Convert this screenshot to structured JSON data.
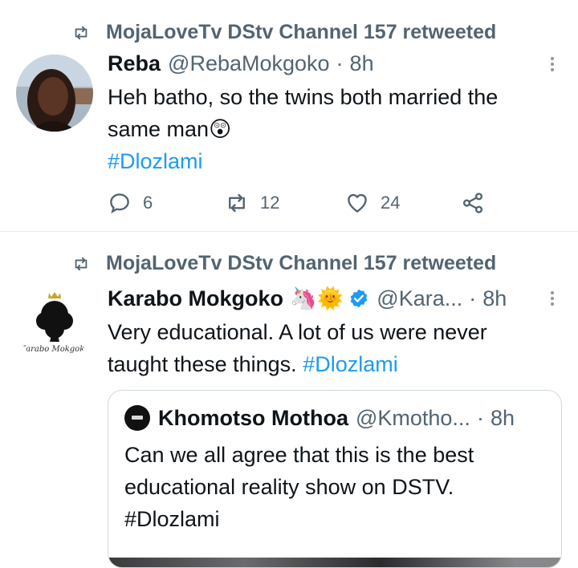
{
  "tweets": [
    {
      "retweet_label": "MojaLoveTv DStv Channel 157 retweeted",
      "name": "Reba",
      "handle": "@RebaMokgoko",
      "time": "8h",
      "text_line1": "Heh batho, so the twins both married the",
      "text_line2": "same man",
      "emoji": "😲",
      "hashtag": "#Dlozlami",
      "replies": "6",
      "retweets": "12",
      "likes": "24"
    },
    {
      "retweet_label": "MojaLoveTv DStv Channel 157 retweeted",
      "name": "Karabo Mokgoko",
      "name_emojis": "🦄🌞",
      "avatar_script": "Karabo Mokgoko",
      "handle": "@Kara...",
      "time": "8h",
      "text_line1": "Very educational. A lot of us were never",
      "text_line2": "taught these things.",
      "hashtag": "#Dlozlami",
      "quote": {
        "name": "Khomotso Mothoa",
        "handle": "@Kmotho...",
        "time": "8h",
        "line1": "Can we all agree that this is the best",
        "line2": "educational reality show on DSTV.",
        "hashtag": "#Dlozlami"
      }
    }
  ],
  "separator": "·",
  "colors": {
    "link": "#1d9bf0",
    "muted": "#536471",
    "text": "#0f1419",
    "verified": "#1d9bf0"
  }
}
